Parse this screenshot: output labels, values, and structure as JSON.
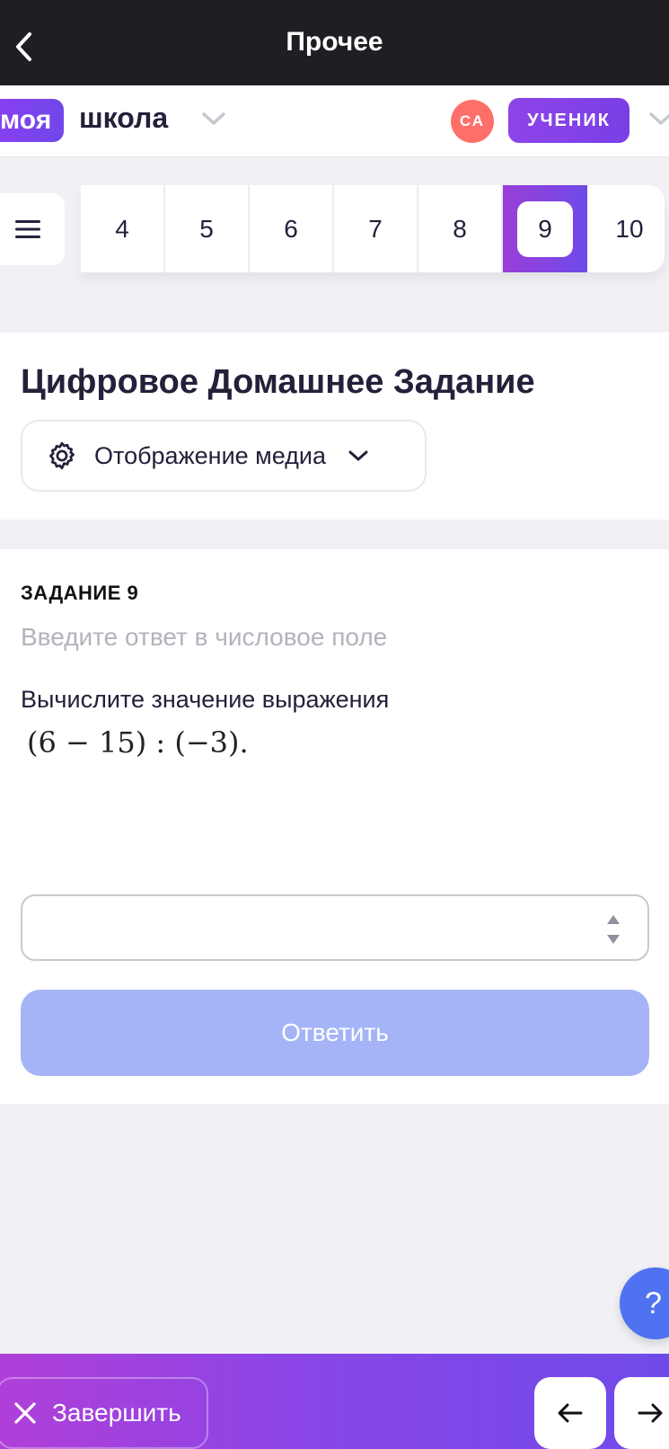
{
  "topbar": {
    "title": "Прочее",
    "back_icon": "chevron-left-icon"
  },
  "brand": {
    "badge": "моя",
    "school": "школа",
    "avatar_initials": "СА",
    "role": "УЧЕНИК"
  },
  "task_nav": {
    "numbers": [
      "4",
      "5",
      "6",
      "7",
      "8",
      "9",
      "10"
    ],
    "selected": "9",
    "accent": "#7a44e6"
  },
  "header": {
    "title": "Цифровое Домашнее Задание",
    "media_dropdown": "Отображение медиа"
  },
  "task": {
    "number_label": "ЗАДАНИЕ 9",
    "hint": "Введите ответ в числовое поле",
    "text": "Вычислите значение выражения",
    "expression": "(6 − 15) : (−3).",
    "answer_value": "",
    "submit_label": "Ответить"
  },
  "help": {
    "label": "?"
  },
  "bottombar": {
    "finish_label": "Завершить"
  },
  "colors": {
    "submit_disabled": "#a4b4f7",
    "avatar": "#ff6f6a",
    "help": "#4f72f0"
  }
}
